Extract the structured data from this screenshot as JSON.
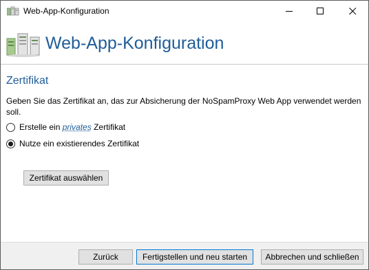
{
  "window": {
    "title": "Web-App-Konfiguration",
    "icon": "server-icon",
    "controls": [
      "minimize-icon",
      "maximize-icon",
      "close-icon"
    ]
  },
  "header": {
    "title": "Web-App-Konfiguration",
    "icon": "server-icon",
    "accent_color": "#1f5c99"
  },
  "section": {
    "title": "Zertifikat",
    "description": "Geben Sie das Zertifikat an, das zur Absicherung der NoSpamProxy Web App verwendet werden soll."
  },
  "options": {
    "private": {
      "before": "Erstelle ein ",
      "link": "privates",
      "after": " Zertifikat",
      "checked": false
    },
    "existing": {
      "label": "Nutze ein existierendes Zertifikat",
      "checked": true
    }
  },
  "buttons": {
    "select_certificate": "Zertifikat auswählen",
    "back": "Zurück",
    "finish": "Fertigstellen und neu starten",
    "cancel": "Abbrechen und schließen"
  }
}
